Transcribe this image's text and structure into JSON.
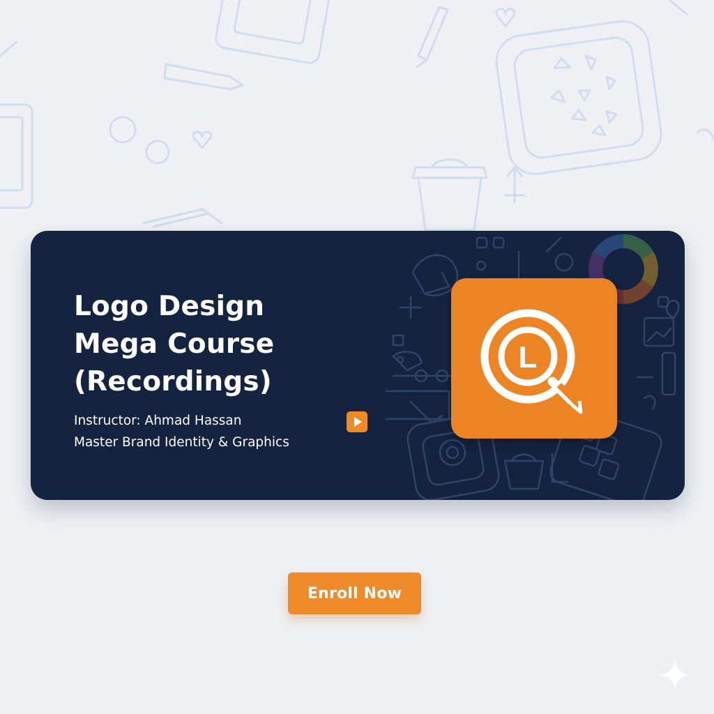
{
  "banner": {
    "title_lines": [
      "Logo Design",
      "Mega Course",
      "(Recordings)"
    ],
    "instructor": "Instructor: Ahmad Hassan",
    "tagline": "Master Brand Identity & Graphics",
    "logo_letter": "L",
    "icons": {
      "play": "play-icon",
      "logo": "magnifier-pencil-logo-icon"
    }
  },
  "cta": {
    "label": "Enroll Now"
  },
  "colors": {
    "banner_background": "#14233f",
    "accent_orange": "#ed8424",
    "page_background": "#eef0f3",
    "text": "#ffffff"
  }
}
